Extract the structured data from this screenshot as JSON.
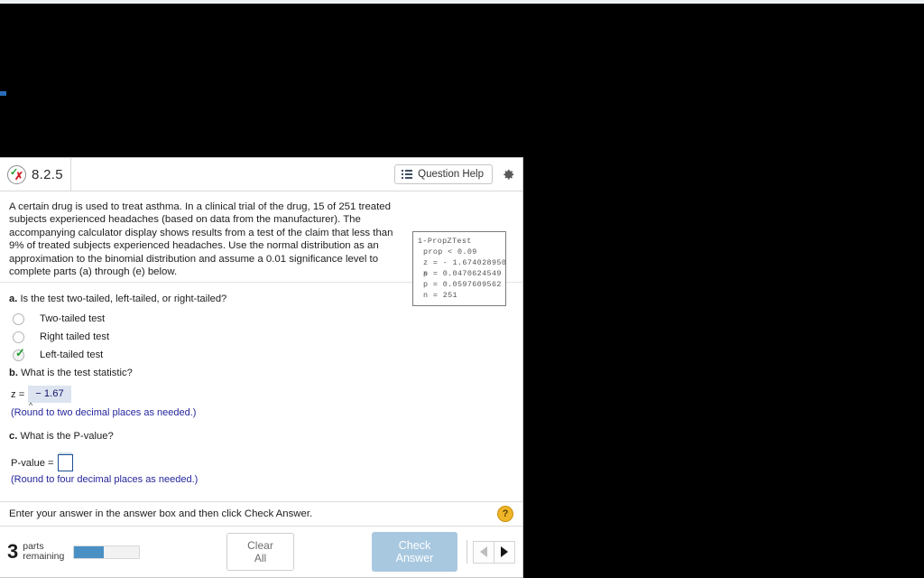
{
  "header": {
    "question_number": "8.2.5",
    "status_icon": "check-x-icon",
    "question_help_label": "Question Help",
    "question_help_icon": "list-icon",
    "settings_icon": "gear-icon"
  },
  "statement": {
    "text": "A certain drug is used to treat asthma. In a clinical trial of the drug, 15 of 251 treated subjects experienced headaches (based on data from the manufacturer). The accompanying calculator display shows results from a test of the claim that less than 9% of treated subjects experienced headaches. Use the normal distribution as an approximation to the binomial distribution and assume a 0.01 significance level to complete parts (a) through (e) below."
  },
  "calculator": {
    "title": "1-PropZTest",
    "lines": [
      "prop < 0.09",
      "z = - 1.674028950",
      "p = 0.0470624549",
      "p = 0.0597609562",
      "n = 251"
    ],
    "hat_symbol": "^"
  },
  "parts": {
    "a": {
      "label": "a.",
      "question": "Is the test two-tailed, left-tailed, or right-tailed?",
      "choices": [
        {
          "label": "Two-tailed test",
          "selected": false
        },
        {
          "label": "Right tailed test",
          "selected": false
        },
        {
          "label": "Left-tailed test",
          "selected": true
        }
      ]
    },
    "b": {
      "label": "b.",
      "question": "What is the test statistic?",
      "answer_lead": "z =",
      "answer_value": "− 1.67",
      "caret": "^",
      "hint": "(Round to two decimal places as needed.)"
    },
    "c": {
      "label": "c.",
      "question": "What is the P-value?",
      "answer_lead": "P-value =",
      "answer_value": "",
      "hint": "(Round to four decimal places as needed.)"
    }
  },
  "footer": {
    "message": "Enter your answer in the answer box and then click Check Answer.",
    "help_icon_label": "?",
    "parts_count": "3",
    "parts_label_line1": "parts",
    "parts_label_line2": "remaining",
    "progress_percent": 45,
    "clear_all_label": "Clear All",
    "check_answer_label": "Check Answer",
    "prev_icon": "triangle-left-icon",
    "next_icon": "triangle-right-icon"
  },
  "colors": {
    "accent_blue": "#4a90c4",
    "check_answer_bg": "#a8c8e0",
    "hint_text": "#25259c",
    "answer_fill_bg": "#dde4f0",
    "answer_fill_text": "#11126a",
    "correct_green": "#1f9d2f",
    "wrong_red": "#cc2026",
    "help_yellow": "#f0b429"
  }
}
